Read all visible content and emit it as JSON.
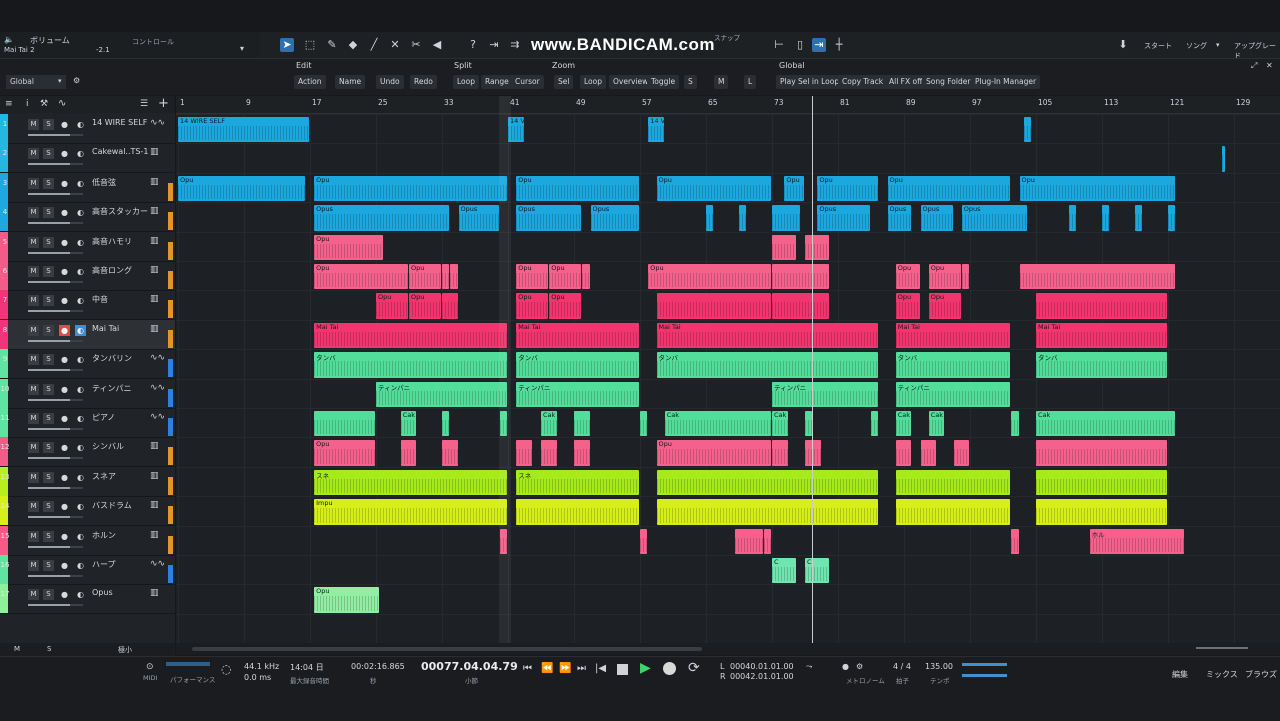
{
  "top": {
    "volume_label": "ボリューム",
    "track_name": "Mai Tai 2",
    "volume_value": "-2.1",
    "control_label": "コントロール",
    "watermark": "www.BANDICAM.com",
    "snap_label": "スナップ",
    "right_tabs": [
      "スタート",
      "ソング",
      "アップグレード"
    ]
  },
  "ctrl": {
    "global_select": "Global",
    "groups": {
      "edit": {
        "title": "Edit",
        "buttons": [
          "Action",
          "Name",
          "Undo",
          "Redo"
        ]
      },
      "split": {
        "title": "Split",
        "buttons": [
          "Loop",
          "Range",
          "Cursor"
        ]
      },
      "zoom": {
        "title": "Zoom",
        "buttons": [
          "Sel",
          "Loop",
          "Overview",
          "Toggle",
          "S",
          "M",
          "L"
        ]
      },
      "global": {
        "title": "Global",
        "buttons": [
          "Play Sel in Loop",
          "Copy Track",
          "All FX off",
          "Song Folder",
          "Plug-In Manager"
        ]
      }
    }
  },
  "ruler": [
    "1",
    "9",
    "17",
    "25",
    "33",
    "41",
    "49",
    "57",
    "65",
    "73",
    "81",
    "89",
    "97",
    "105",
    "113",
    "121",
    "129"
  ],
  "tracks": [
    {
      "num": "1",
      "name": "14 WIRE SELF",
      "icon": "audio-wave-icon",
      "color": "#25b7df"
    },
    {
      "num": "2",
      "name": "Cakewal..TS-1",
      "icon": "piano-icon",
      "color": "#25b7df"
    },
    {
      "num": "3",
      "name": "低音弦",
      "icon": "piano-icon",
      "color": "#1da9e0"
    },
    {
      "num": "4",
      "name": "高音スタッカート",
      "icon": "piano-icon",
      "color": "#1da9e0"
    },
    {
      "num": "5",
      "name": "高音ハモリ",
      "icon": "piano-icon",
      "color": "#f25c86"
    },
    {
      "num": "6",
      "name": "高音ロング",
      "icon": "piano-icon",
      "color": "#f25c86"
    },
    {
      "num": "7",
      "name": "中音",
      "icon": "piano-icon",
      "color": "#f2347a"
    },
    {
      "num": "8",
      "name": "Mai Tai",
      "icon": "piano-icon",
      "color": "#f2347a"
    },
    {
      "num": "9",
      "name": "タンバリン",
      "icon": "audio-wave-icon",
      "color": "#5fe3a0"
    },
    {
      "num": "10",
      "name": "ティンパニ",
      "icon": "audio-wave-icon",
      "color": "#5fe3a0"
    },
    {
      "num": "11",
      "name": "ピアノ",
      "icon": "audio-wave-icon",
      "color": "#5fe3a0"
    },
    {
      "num": "12",
      "name": "シンバル",
      "icon": "piano-icon",
      "color": "#f25c86"
    },
    {
      "num": "13",
      "name": "スネア",
      "icon": "piano-icon",
      "color": "#b6ee1e"
    },
    {
      "num": "14",
      "name": "バスドラム",
      "icon": "piano-icon",
      "color": "#d7f01c"
    },
    {
      "num": "15",
      "name": "ホルン",
      "icon": "piano-icon",
      "color": "#f25c86"
    },
    {
      "num": "16",
      "name": "ハープ",
      "icon": "audio-wave-icon",
      "color": "#5fe3a0"
    },
    {
      "num": "17",
      "name": "Opus",
      "icon": "piano-icon",
      "color": "#8fef9b"
    }
  ],
  "clip_labels": {
    "t1": "14 WIRE SELF",
    "t1b": "14 V",
    "t3": "Opu",
    "t4": "Opus",
    "t6": "Opu",
    "t7": "Opu",
    "t8": "Mai Tai",
    "t9": "タンバ",
    "t10": "ティンパニ",
    "t11": "Cak",
    "t12": "Opu",
    "t13": "スネ",
    "t14": "Impu",
    "t15": "ホル",
    "t16": "C",
    "t17": "Opu"
  },
  "transport": {
    "midi": "MIDI",
    "performance": "パフォーマンス",
    "sample_rate": "44.1 kHz",
    "latency": "0.0 ms",
    "record_time": "14:04 日",
    "record_time_label": "最大録音時間",
    "time_seconds": "00:02:16.865",
    "seconds_label": "秒",
    "position": "00077.04.04.79",
    "bars_label": "小節",
    "loop_l_label": "L",
    "loop_r_label": "R",
    "loop_l": "00040.01.01.00",
    "loop_r": "00042.01.01.00",
    "metronome": "メトロノーム",
    "time_sig": "4 / 4",
    "time_sig_label": "拍子",
    "tempo": "135.00",
    "tempo_label": "テンポ",
    "right_tabs": [
      "編集",
      "ミックス",
      "ブラウズ"
    ]
  },
  "bottom_left": [
    "M",
    "S",
    "極小"
  ]
}
